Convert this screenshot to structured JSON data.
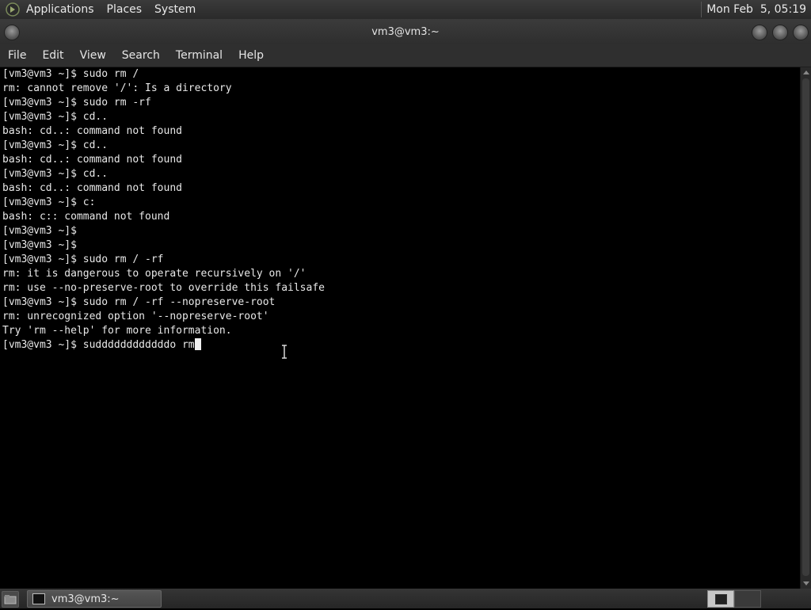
{
  "top_panel": {
    "menus": [
      "Applications",
      "Places",
      "System"
    ],
    "clock": "Mon Feb  5, 05:19"
  },
  "window": {
    "title": "vm3@vm3:~"
  },
  "menu_bar": {
    "items": [
      "File",
      "Edit",
      "View",
      "Search",
      "Terminal",
      "Help"
    ]
  },
  "terminal": {
    "lines": [
      "[vm3@vm3 ~]$ sudo rm /",
      "rm: cannot remove '/': Is a directory",
      "[vm3@vm3 ~]$ sudo rm -rf",
      "[vm3@vm3 ~]$ cd..",
      "bash: cd..: command not found",
      "[vm3@vm3 ~]$ cd..",
      "bash: cd..: command not found",
      "[vm3@vm3 ~]$ cd..",
      "bash: cd..: command not found",
      "[vm3@vm3 ~]$ c:",
      "bash: c:: command not found",
      "[vm3@vm3 ~]$",
      "[vm3@vm3 ~]$",
      "[vm3@vm3 ~]$ sudo rm / -rf",
      "rm: it is dangerous to operate recursively on '/'",
      "rm: use --no-preserve-root to override this failsafe",
      "[vm3@vm3 ~]$ sudo rm / -rf --nopreserve-root",
      "rm: unrecognized option '--nopreserve-root'",
      "Try 'rm --help' for more information.",
      "[vm3@vm3 ~]$ suddddddddddddo rm"
    ]
  },
  "taskbar": {
    "task_label": "vm3@vm3:~"
  },
  "icons": {
    "app_logo": "gnome-foot-icon",
    "terminal": "terminal-icon"
  }
}
